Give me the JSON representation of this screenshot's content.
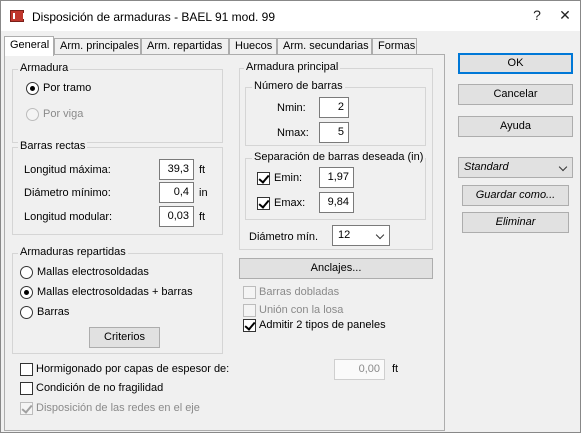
{
  "window": {
    "title": "Disposición de armaduras - BAEL 91 mod. 99"
  },
  "tabs": [
    {
      "label": "General"
    },
    {
      "label": "Arm. principales"
    },
    {
      "label": "Arm. repartidas"
    },
    {
      "label": "Huecos"
    },
    {
      "label": "Arm. secundarias"
    },
    {
      "label": "Formas"
    }
  ],
  "armadura": {
    "title": "Armadura",
    "por_tramo": "Por tramo",
    "por_viga": "Por viga"
  },
  "barras_rectas": {
    "title": "Barras rectas",
    "longitud_maxima": {
      "label": "Longitud máxima:",
      "value": "39,3",
      "unit": "ft"
    },
    "diametro_minimo": {
      "label": "Diámetro mínimo:",
      "value": "0,4",
      "unit": "in"
    },
    "longitud_modular": {
      "label": "Longitud modular:",
      "value": "0,03",
      "unit": "ft"
    }
  },
  "armaduras_repartidas": {
    "title": "Armaduras repartidas",
    "options": [
      "Mallas electrosoldadas",
      "Mallas electrosoldadas + barras",
      "Barras"
    ],
    "criterios": "Criterios"
  },
  "armadura_principal": {
    "title": "Armadura principal",
    "numero_barras": {
      "title": "Número de barras",
      "nmin_label": "Nmin:",
      "nmin": "2",
      "nmax_label": "Nmax:",
      "nmax": "5"
    },
    "separacion": {
      "title": "Separación de barras deseada (in)",
      "emin_label": "Emin:",
      "emin": "1,97",
      "emax_label": "Emax:",
      "emax": "9,84"
    },
    "diametro_min_label": "Diámetro mín.",
    "diametro_min_value": "12",
    "anclajes": "Anclajes...",
    "barras_dobladas": "Barras dobladas",
    "union_losa": "Unión con la losa",
    "admitir_paneles": "Admitir 2 tipos de paneles"
  },
  "bottom": {
    "hormigonado": "Hormigonado por capas de espesor de:",
    "hormigonado_value": "0,00",
    "hormigonado_unit": "ft",
    "condicion": "Condición de no fragilidad",
    "disposicion": "Disposición de las redes en el eje"
  },
  "side": {
    "ok": "OK",
    "cancelar": "Cancelar",
    "ayuda": "Ayuda",
    "preset": "Standard",
    "guardar": "Guardar como...",
    "eliminar": "Eliminar"
  }
}
